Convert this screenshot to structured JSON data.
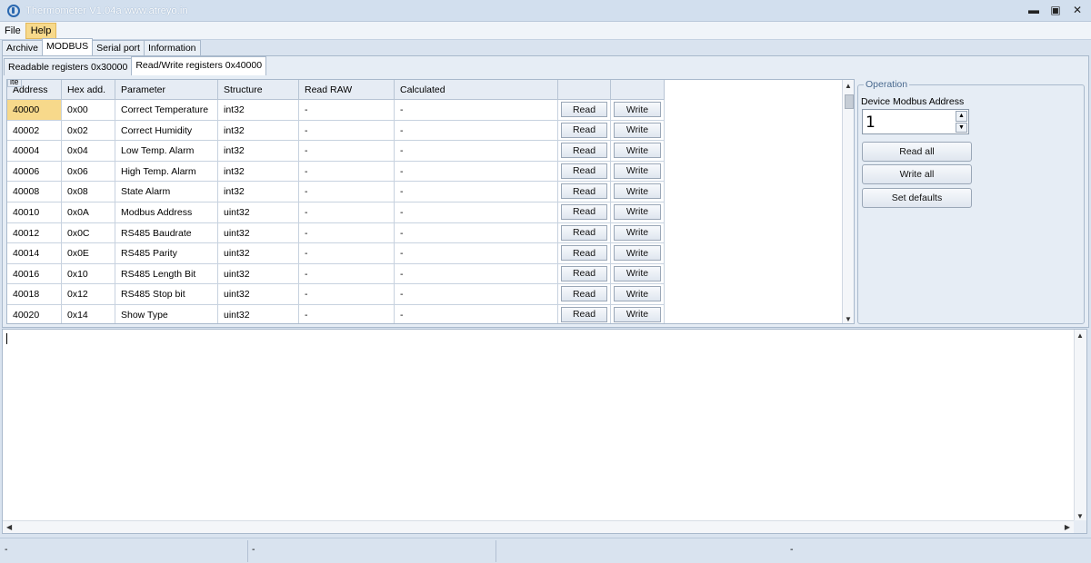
{
  "window": {
    "title": "Thermometer V1.04a www.atreyo.in",
    "min": "▬",
    "max": "▣",
    "close": "✕"
  },
  "menu": {
    "file": "File",
    "help": "Help"
  },
  "tabs": [
    "Archive",
    "MODBUS",
    "Serial port",
    "Information"
  ],
  "subtabs": [
    "Readable registers 0x30000",
    "Read/Write registers 0x40000"
  ],
  "grid": {
    "corner_mark": "ite",
    "headers": [
      "Address",
      "Hex add.",
      "Parameter",
      "Structure",
      "Read RAW",
      "Calculated",
      "",
      ""
    ],
    "button_labels": {
      "read": "Read",
      "write": "Write"
    },
    "rows": [
      [
        "40000",
        "0x00",
        "Correct Temperature",
        "int32",
        "-",
        "-"
      ],
      [
        "40002",
        "0x02",
        "Correct Humidity",
        "int32",
        "-",
        "-"
      ],
      [
        "40004",
        "0x04",
        "Low Temp. Alarm",
        "int32",
        "-",
        "-"
      ],
      [
        "40006",
        "0x06",
        "High Temp. Alarm",
        "int32",
        "-",
        "-"
      ],
      [
        "40008",
        "0x08",
        "State Alarm",
        "int32",
        "-",
        "-"
      ],
      [
        "40010",
        "0x0A",
        "Modbus Address",
        "uint32",
        "-",
        "-"
      ],
      [
        "40012",
        "0x0C",
        "RS485 Baudrate",
        "uint32",
        "-",
        "-"
      ],
      [
        "40014",
        "0x0E",
        "RS485 Parity",
        "uint32",
        "-",
        "-"
      ],
      [
        "40016",
        "0x10",
        "RS485 Length Bit",
        "uint32",
        "-",
        "-"
      ],
      [
        "40018",
        "0x12",
        "RS485 Stop bit",
        "uint32",
        "-",
        "-"
      ],
      [
        "40020",
        "0x14",
        "Show Type",
        "uint32",
        "-",
        "-"
      ]
    ]
  },
  "operation": {
    "legend": "Operation",
    "address_label": "Device Modbus Address",
    "address_value": "1",
    "read_all": "Read all",
    "write_all": "Write all",
    "set_defaults": "Set defaults"
  },
  "status": [
    "-",
    "-",
    "-"
  ],
  "colors": {
    "selection": "#f7d98b",
    "titlebar": "#d2dfee",
    "panel": "#e6edf5"
  }
}
